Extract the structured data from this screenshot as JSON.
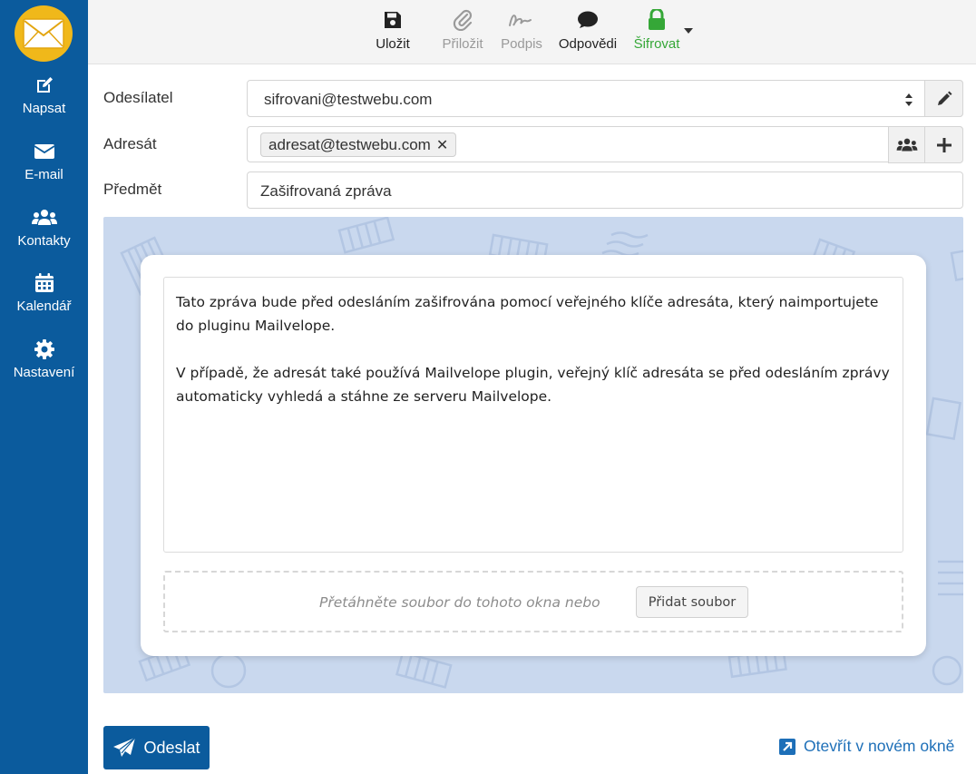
{
  "sidebar": {
    "items": [
      {
        "label": "Napsat",
        "icon": "edit-icon"
      },
      {
        "label": "E-mail",
        "icon": "envelope-icon"
      },
      {
        "label": "Kontakty",
        "icon": "users-icon"
      },
      {
        "label": "Kalendář",
        "icon": "calendar-icon"
      },
      {
        "label": "Nastavení",
        "icon": "gear-icon"
      }
    ]
  },
  "toolbar": {
    "save": "Uložit",
    "attach": "Přiložit",
    "signature": "Podpis",
    "responses": "Odpovědi",
    "encrypt": "Šifrovat"
  },
  "form": {
    "from_label": "Odesílatel",
    "from_value": "sifrovani@testwebu.com",
    "to_label": "Adresát",
    "to_recipient": "adresat@testwebu.com",
    "subject_label": "Předmět",
    "subject_value": "Zašifrovaná zpráva"
  },
  "editor": {
    "paragraph1": "Tato zpráva bude před odesláním zašifrována pomocí veřejného klíče adresáta, který naimportujete do pluginu Mailvelope.",
    "paragraph2": "V případě, že adresát také používá Mailvelope plugin, veřejný klíč adresáta se před odesláním zprávy automaticky vyhledá a stáhne ze serveru Mailvelope.",
    "dropzone_text": "Přetáhněte soubor do tohoto okna nebo",
    "add_file": "Přidat soubor"
  },
  "footer": {
    "send": "Odeslat",
    "open_new_window": "Otevřít v novém okně"
  },
  "colors": {
    "sidebar": "#0b5b9d",
    "encrypt_green": "#35a737",
    "link_blue": "#1d6fb8",
    "editor_bg": "#c9d8ee",
    "logo": "#f0b81a"
  }
}
